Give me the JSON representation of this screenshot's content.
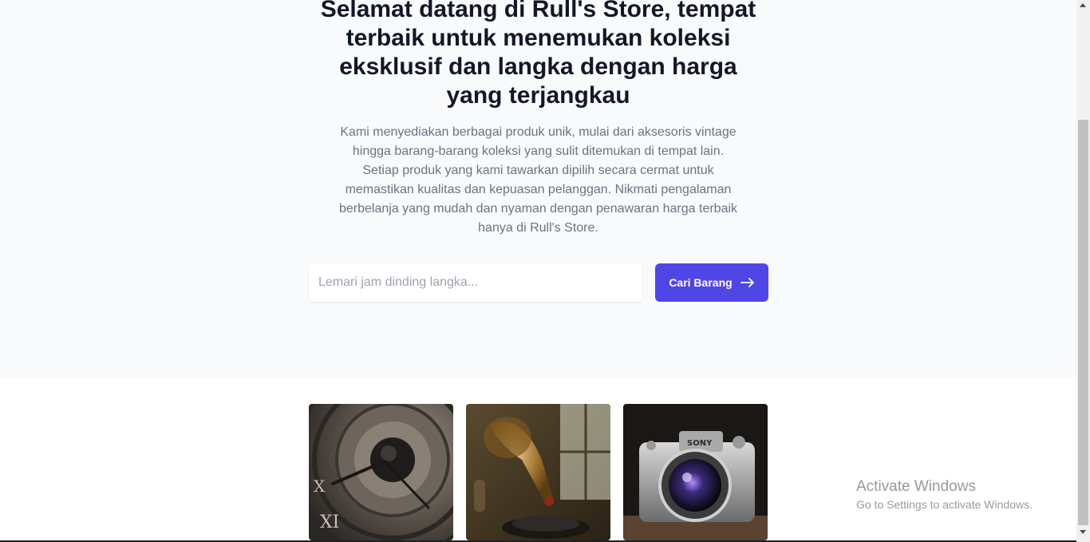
{
  "hero": {
    "title": "Selamat datang di Rull's Store, tempat terbaik untuk menemukan koleksi eksklusif dan langka dengan harga yang terjangkau",
    "description": "Kami menyediakan berbagai produk unik, mulai dari aksesoris vintage hingga barang-barang koleksi yang sulit ditemukan di tempat lain. Setiap produk yang kami tawarkan dipilih secara cermat untuk memastikan kualitas dan kepuasan pelanggan. Nikmati pengalaman berbelanja yang mudah dan nyaman dengan penawaran harga terbaik hanya di Rull's Store."
  },
  "search": {
    "placeholder": "Lemari jam dinding langka...",
    "value": "",
    "button_label": "Cari Barang",
    "button_icon": "arrow-right-icon"
  },
  "products": {
    "camera_brand": "SONY"
  },
  "colors": {
    "accent": "#4f46e5",
    "hero_background": "#f9fafb",
    "heading": "#111827",
    "body_text": "#6b7280"
  },
  "watermark": {
    "title": "Activate Windows",
    "subtitle": "Go to Settings to activate Windows."
  }
}
